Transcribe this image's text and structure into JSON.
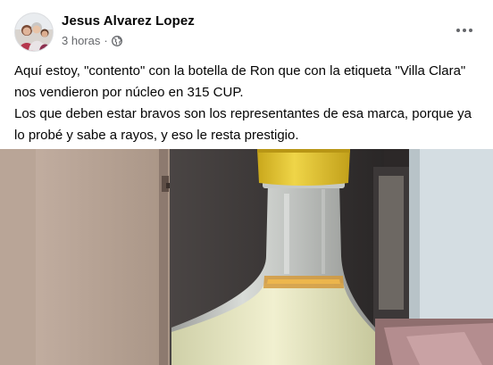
{
  "post": {
    "author": "Jesus Alvarez Lopez",
    "time": "3 horas",
    "separator": "·",
    "privacy_icon": "globe-icon",
    "more_icon": "more-options-icon",
    "text_line1": "Aquí estoy, \"contento\" con la botella de Ron que con la etiqueta \"Villa Clara\" nos vendieron por núcleo en 315 CUP.",
    "text_line2": "Los que deben estar bravos son los representantes de esa marca, porque ya lo probé y sabe a rayos, y eso le resta prestigio.",
    "photo_subject": "bottle-photo"
  },
  "colors": {
    "author_text": "#050505",
    "meta_text": "#65676b",
    "card_bg": "#ffffff",
    "cap_yellow": "#e8c72c"
  }
}
